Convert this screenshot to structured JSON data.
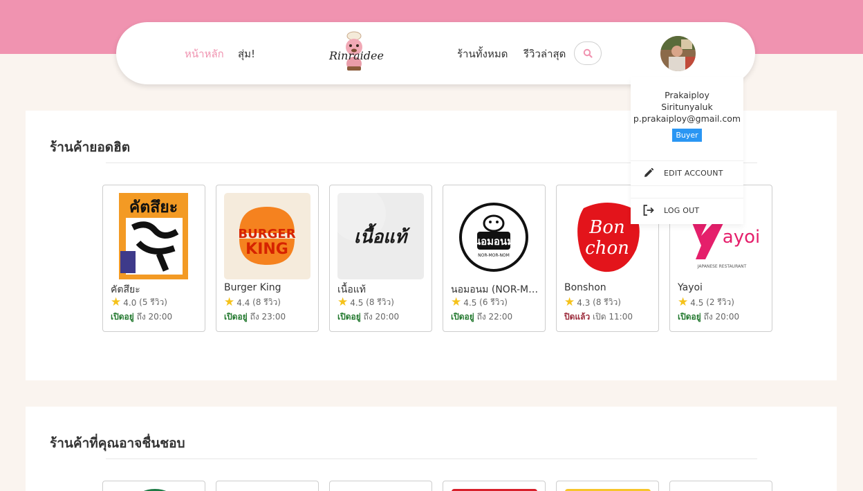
{
  "nav": {
    "home": "หน้าหลัก",
    "random": "สุ่ม!",
    "all_shops": "ร้านทั้งหมด",
    "latest_reviews": "รีวิวล่าสุด",
    "logo_text": "Rinraidee"
  },
  "user_menu": {
    "first_name": "Prakaiploy",
    "last_name": "Siritunyaluk",
    "email": "p.prakaiploy@gmail.com",
    "role": "Buyer",
    "edit_account": "EDIT ACCOUNT",
    "logout": "LOG OUT"
  },
  "section_popular": {
    "title": "ร้านค้ายอดฮิต",
    "shops": [
      {
        "name": "คัตสึยะ",
        "rating": "4.0",
        "reviews": "(5 รีวิว)",
        "status": "เปิดอยู่",
        "hours": "ถึง 20:00",
        "logo_text": "คัตสึยะ"
      },
      {
        "name": "Burger King",
        "rating": "4.4",
        "reviews": "(8 รีวิว)",
        "status": "เปิดอยู่",
        "hours": "ถึง 23:00",
        "logo_text": "BURGER KING"
      },
      {
        "name": "เนื้อแท้",
        "rating": "4.5",
        "reviews": "(8 รีวิว)",
        "status": "เปิดอยู่",
        "hours": "ถึง 20:00",
        "logo_text": "เนื้อแท้"
      },
      {
        "name": "นอมอนม (NOR-MOR-NOM)",
        "rating": "4.5",
        "reviews": "(6 รีวิว)",
        "status": "เปิดอยู่",
        "hours": "ถึง 22:00",
        "logo_text": "นอมอนม"
      },
      {
        "name": "Bonshon",
        "rating": "4.3",
        "reviews": "(8 รีวิว)",
        "status": "ปิดแล้ว",
        "hours": "เปิด 11:00",
        "logo_text": "Bonchon"
      },
      {
        "name": "Yayoi",
        "rating": "4.5",
        "reviews": "(2 รีวิว)",
        "status": "เปิดอยู่",
        "hours": "ถึง 20:00",
        "logo_text": "Yayoi"
      }
    ]
  },
  "section_recommended": {
    "title": "ร้านค้าที่คุณอาจชื่นชอบ"
  },
  "colors": {
    "brand_pink": "#f093b0",
    "open_green": "#22782e",
    "closed_red": "#9b2a3a",
    "badge_blue": "#2a96f3",
    "star": "#f5c21b"
  },
  "icons": [
    "search-icon",
    "star-icon",
    "pencil-icon",
    "logout-icon"
  ]
}
